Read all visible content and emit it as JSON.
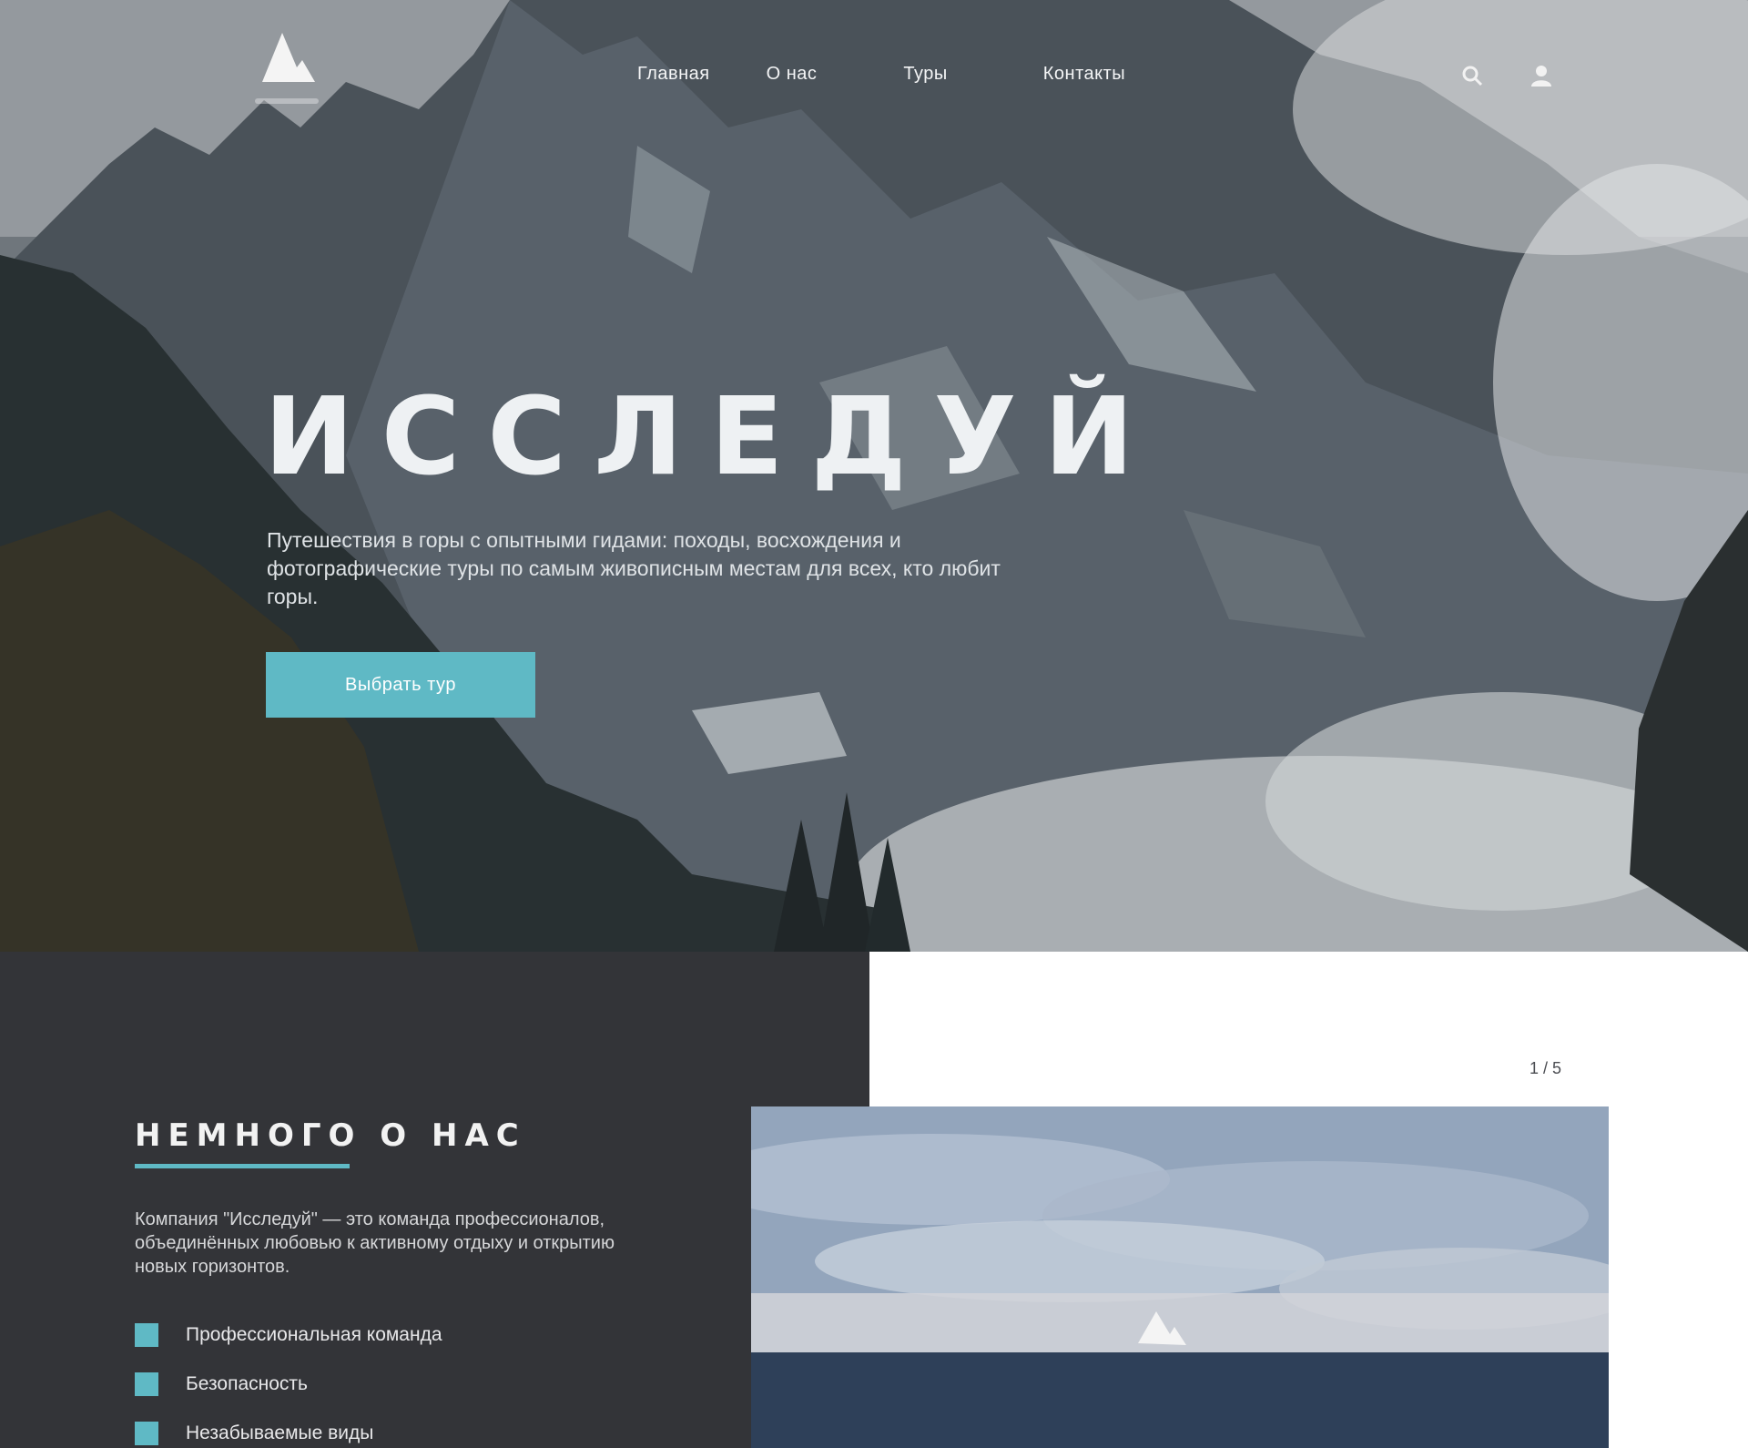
{
  "header": {
    "nav": [
      "Главная",
      "О нас",
      "Туры",
      "Контакты"
    ],
    "icons": [
      "search-icon",
      "user-icon"
    ]
  },
  "hero": {
    "title": "ИССЛЕДУЙ",
    "subtitle": "Путешествия в горы с опытными гидами: походы, восхождения и фотографические туры по самым живописным местам для всех, кто любит горы.",
    "cta": "Выбрать тур"
  },
  "about": {
    "title": "НЕМНОГО О НАС",
    "text": "Компания \"Исследуй\" — это команда профессионалов, объединённых любовью к активному отдыху и открытию новых горизонтов.",
    "features": [
      "Профессиональная команда",
      "Безопасность",
      "Незабываемые виды"
    ]
  },
  "gallery": {
    "pager": "1 / 5"
  },
  "colors": {
    "accent": "#5fb9c5",
    "dark_panel": "#333438"
  }
}
